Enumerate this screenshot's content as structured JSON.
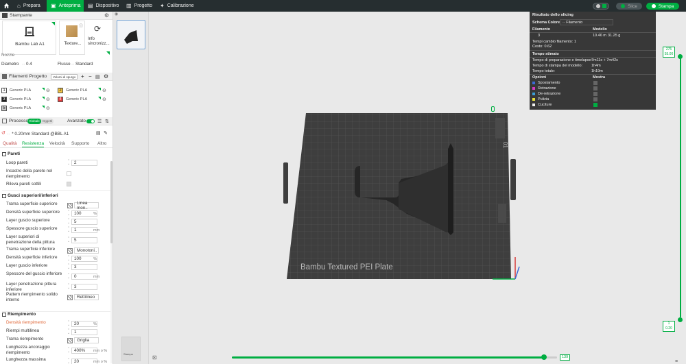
{
  "topbar": {
    "home_icon": "home-icon",
    "tabs": [
      {
        "label": "Prepara",
        "icon": "prepare-icon"
      },
      {
        "label": "Anteprima",
        "icon": "preview-icon"
      },
      {
        "label": "Dispositivo",
        "icon": "device-icon"
      },
      {
        "label": "Progetto",
        "icon": "project-icon"
      },
      {
        "label": "Calibrazione",
        "icon": "calibration-icon"
      }
    ],
    "slice_label": "Slice",
    "print_label": "Stampa",
    "accent": "#00ae42"
  },
  "printer": {
    "section_title": "Stampante",
    "printer_name": "Bambu Lab A1",
    "plate_label": "Texture...",
    "sync_label": "Info sincronizz...",
    "nozzle_label": "Nozzle",
    "diameter_label": "Diametro",
    "diameter_value": "0.4",
    "flow_label": "Flusso",
    "flow_value": "Standard"
  },
  "filaments": {
    "section_title": "Filamenti Progetto",
    "volume_button": "Volumi di spurgo",
    "items": [
      {
        "num": "1",
        "name": "Generic PLA",
        "color": "#ffffff"
      },
      {
        "num": "2",
        "name": "Generic PLA",
        "color": "#f5c542"
      },
      {
        "num": "3",
        "name": "Generic PLA",
        "color": "#222222"
      },
      {
        "num": "4",
        "name": "Generic PLA",
        "color": "#e23b3b"
      },
      {
        "num": "5",
        "name": "Generic PLA",
        "color": "#c8c8c8"
      }
    ]
  },
  "process": {
    "section_title": "Processo",
    "toggle_a": "Globale",
    "toggle_b": "Oggetti",
    "advanced_label": "Avanzato",
    "profile": "* 0.20mm Standard @BBL A1",
    "tabs": [
      "Qualità",
      "Resistenza",
      "Velocità",
      "Supporto",
      "Altro"
    ],
    "walls": {
      "title": "Pareti",
      "loops_label": "Loop pareti",
      "loops_value": "2",
      "infill_between_label": "Incastro della parete nel riempimento",
      "detect_thin_label": "Rileva pareti sottili"
    },
    "shells": {
      "title": "Gusci superiori/inferiori",
      "rows": [
        {
          "label": "Trama superficie superiore",
          "value": "Linea mon..",
          "unit": ""
        },
        {
          "label": "Densità superficie superiore",
          "value": "100",
          "unit": "%"
        },
        {
          "label": "Layer guscio superiore",
          "value": "5",
          "unit": ""
        },
        {
          "label": "Spessore guscio superiore",
          "value": "1",
          "unit": "mm"
        },
        {
          "label": "Layer superiori di penetrazione della pittura",
          "value": "5",
          "unit": ""
        },
        {
          "label": "Trama superficie inferiore",
          "value": "Monotoni..",
          "unit": ""
        },
        {
          "label": "Densità superficie inferiore",
          "value": "100",
          "unit": "%"
        },
        {
          "label": "Layer guscio inferiore",
          "value": "3",
          "unit": ""
        },
        {
          "label": "Spessore del guscio inferiore",
          "value": "0",
          "unit": "mm"
        },
        {
          "label": "Layer penetrazione pittura inferiore",
          "value": "3",
          "unit": ""
        },
        {
          "label": "Pattern riempimento solido interno",
          "value": "Rettilineo",
          "unit": ""
        }
      ]
    },
    "infill": {
      "title": "Riempimento",
      "rows": [
        {
          "label": "Densità riempimento",
          "value": "20",
          "unit": "%"
        },
        {
          "label": "Riempi multilinea",
          "value": "1",
          "unit": ""
        },
        {
          "label": "Trama riempimento",
          "value": "Griglia",
          "unit": ""
        },
        {
          "label": "Lunghezza ancoraggio riempimento",
          "value": "400%",
          "unit": "mm o %"
        },
        {
          "label": "Lunghezza massima",
          "value": "20",
          "unit": "mm o %"
        }
      ]
    }
  },
  "slicing": {
    "title": "Risultato dello slicing",
    "color_scheme_label": "Schema Colore",
    "color_scheme_value": "Filamento",
    "col_filament": "Filamento",
    "col_model": "Modello",
    "filament_num": "3",
    "filament_length": "10.46 m",
    "filament_weight": "31.25 g",
    "changes_label": "Tempi cambio filamento:",
    "changes_value": "1",
    "cost_label": "Costo:",
    "cost_value": "0.62",
    "time_title": "Tempo stimato",
    "prep_label": "Tempo di preparazione e timelapse:",
    "prep_value": "7m11s + 7m42s",
    "model_time_label": "Tempo di stampa del modello:",
    "model_time_value": "1h4m",
    "total_label": "Tempo totale:",
    "total_value": "1h19m",
    "options_label": "Opzioni",
    "show_label": "Mostra",
    "options": [
      {
        "name": "Spostamento",
        "color": "#3b6bd6",
        "shown": false
      },
      {
        "name": "Retrazione",
        "color": "#d63bc0",
        "shown": false
      },
      {
        "name": "De-retrazione",
        "color": "#3b9ed6",
        "shown": false
      },
      {
        "name": "Pulizia",
        "color": "#e8e03b",
        "shown": false
      },
      {
        "name": "Cuciture",
        "color": "#f0f0f0",
        "shown": true
      }
    ]
  },
  "bed": {
    "label": "Bambu Textured PEI Plate",
    "plate_number": "01"
  },
  "layer_slider": {
    "top_layer": "275",
    "top_height": "55.00",
    "bottom_layer": "1",
    "bottom_height": "0.20"
  },
  "move_slider": {
    "value": "139",
    "progress": 0.96
  },
  "thumbnail": {
    "label": "Stampa"
  }
}
